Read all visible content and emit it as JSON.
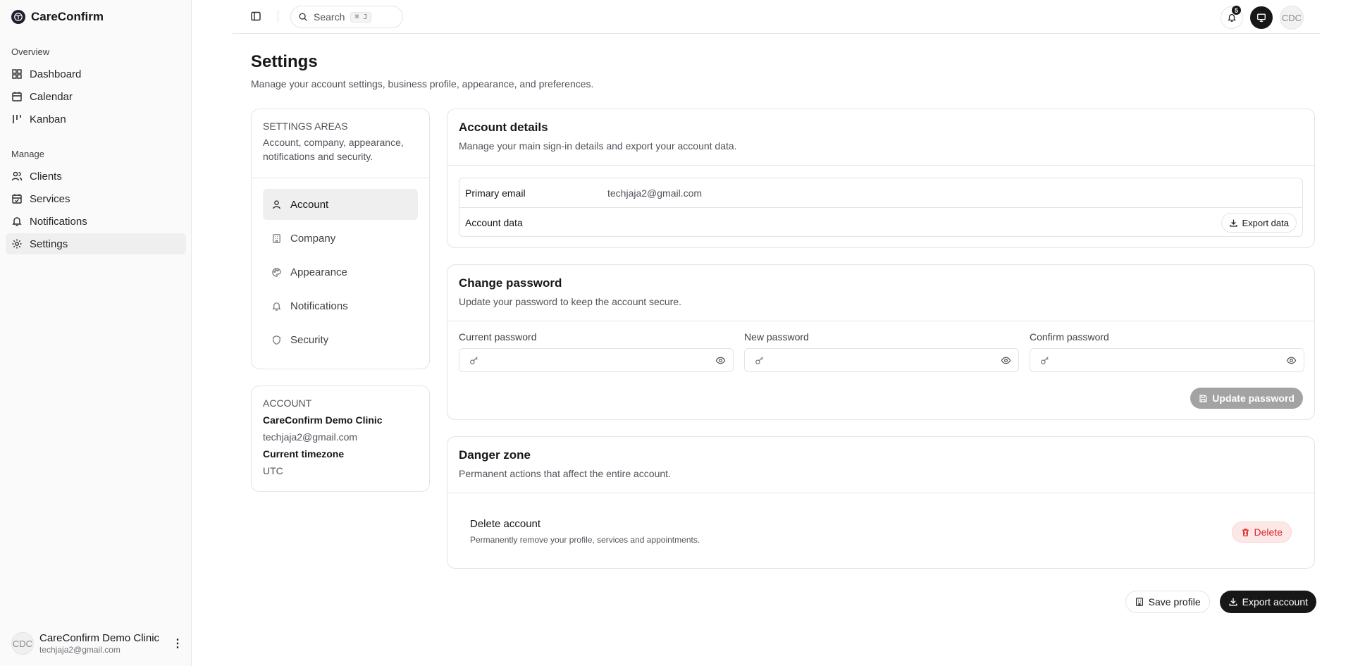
{
  "app": {
    "name": "CareConfirm"
  },
  "sidebar": {
    "overview_label": "Overview",
    "manage_label": "Manage",
    "overview_items": [
      {
        "label": "Dashboard",
        "icon": "grid-icon"
      },
      {
        "label": "Calendar",
        "icon": "calendar-icon"
      },
      {
        "label": "Kanban",
        "icon": "kanban-icon"
      }
    ],
    "manage_items": [
      {
        "label": "Clients",
        "icon": "users-icon"
      },
      {
        "label": "Services",
        "icon": "calendar-check-icon"
      },
      {
        "label": "Notifications",
        "icon": "bell-icon"
      },
      {
        "label": "Settings",
        "icon": "gear-icon",
        "active": true
      }
    ],
    "user": {
      "initials": "CDC",
      "name": "CareConfirm Demo Clinic",
      "email": "techjaja2@gmail.com"
    }
  },
  "topbar": {
    "search_placeholder": "Search",
    "search_shortcut": "⌘ J",
    "notification_count": "5",
    "avatar_initials": "CDC"
  },
  "page": {
    "title": "Settings",
    "subtitle": "Manage your account settings, business profile, appearance, and preferences."
  },
  "settings_areas": {
    "title": "SETTINGS AREAS",
    "description": "Account, company, appearance, notifications and security.",
    "items": [
      {
        "label": "Account",
        "icon": "user-icon",
        "active": true
      },
      {
        "label": "Company",
        "icon": "building-icon"
      },
      {
        "label": "Appearance",
        "icon": "palette-icon"
      },
      {
        "label": "Notifications",
        "icon": "bell-icon"
      },
      {
        "label": "Security",
        "icon": "shield-icon"
      }
    ]
  },
  "account_summary": {
    "label": "ACCOUNT",
    "name": "CareConfirm Demo Clinic",
    "email": "techjaja2@gmail.com",
    "timezone_label": "Current timezone",
    "timezone": "UTC"
  },
  "account_details": {
    "title": "Account details",
    "description": "Manage your main sign-in details and export your account data.",
    "primary_email_label": "Primary email",
    "primary_email": "techjaja2@gmail.com",
    "account_data_label": "Account data",
    "export_label": "Export data"
  },
  "change_password": {
    "title": "Change password",
    "description": "Update your password to keep the account secure.",
    "current_label": "Current password",
    "new_label": "New password",
    "confirm_label": "Confirm password",
    "update_label": "Update password"
  },
  "danger_zone": {
    "title": "Danger zone",
    "description": "Permanent actions that affect the entire account.",
    "delete_title": "Delete account",
    "delete_desc": "Permanently remove your profile, services and appointments.",
    "delete_label": "Delete"
  },
  "actions": {
    "save_label": "Save profile",
    "export_label": "Export account"
  }
}
